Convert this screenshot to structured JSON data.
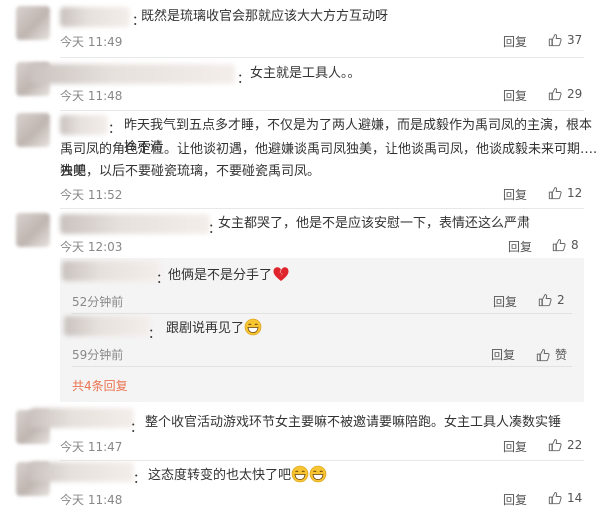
{
  "comments": [
    {
      "text": "既然是琉璃收官会那就应该大大方方互动呀",
      "time": "今天 11:49",
      "reply": "回复",
      "likes": "37"
    },
    {
      "text": "女主就是工具人。。",
      "time": "今天 11:48",
      "reply": "回复",
      "likes": "29"
    },
    {
      "text_lines": [
        "昨天我气到五点多才睡，不仅是为了两人避嫌，而是成毅作为禹司凤的主演，根本拎不清",
        "禹司凤的角色定位。让他谈初遇，他避嫌谈禹司凤独美，让他谈禹司凤，他谈成毅未来可期….独美",
        "去吧，以后不要碰瓷琉璃，不要碰瓷禹司凤。"
      ],
      "time": "今天 11:52",
      "reply": "回复",
      "likes": "12"
    },
    {
      "text": "女主都哭了，他是不是应该安慰一下，表情还这么严肃",
      "time": "今天 12:03",
      "reply": "回复",
      "likes": "8",
      "replies": [
        {
          "text": "他俩是不是分手了",
          "emoji": "broken-heart",
          "time": "52分钟前",
          "reply": "回复",
          "likes": "2"
        },
        {
          "text": "跟剧说再见了",
          "emoji": "grin",
          "time": "59分钟前",
          "reply": "回复",
          "likes": "赞"
        }
      ],
      "more_replies": "共4条回复"
    },
    {
      "text": "整个收官活动游戏环节女主要嘛不被邀请要嘛陪跑。女主工具人凑数实锤",
      "time": "今天 11:47",
      "reply": "回复",
      "likes": "22"
    },
    {
      "text": "这态度转变的也太快了吧",
      "emoji": "grin-grin",
      "time": "今天 11:48",
      "reply": "回复",
      "likes": "14"
    }
  ],
  "colors": {
    "accent": "#eb7350",
    "heart": "#e0242b"
  }
}
